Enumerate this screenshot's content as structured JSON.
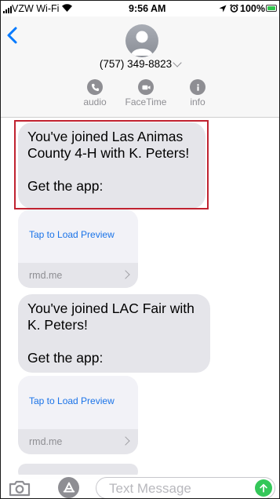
{
  "status": {
    "carrier": "VZW Wi-Fi",
    "time": "9:56 AM",
    "battery_pct": "100%",
    "battery_level": 1.0,
    "battery_color": "#30c44b"
  },
  "header": {
    "contact_number": "(757) 349-8823",
    "actions": [
      {
        "label": "audio",
        "icon": "phone-icon"
      },
      {
        "label": "FaceTime",
        "icon": "video-icon"
      },
      {
        "label": "info",
        "icon": "info-icon"
      }
    ],
    "accent": "#007aff"
  },
  "messages": [
    {
      "line1": "You've joined Las Animas County 4-H with K. Peters!",
      "line2": "Get the app:",
      "highlighted": true
    },
    {
      "line1": "You've joined LAC Fair with K. Peters!",
      "line2": "Get the app:",
      "highlighted": false
    }
  ],
  "link_previews": [
    {
      "load_label": "Tap to Load Preview",
      "domain": "rmd.me"
    },
    {
      "load_label": "Tap to Load Preview",
      "domain": "rmd.me"
    }
  ],
  "composer": {
    "placeholder": "Text Message",
    "value": ""
  },
  "colors": {
    "bubble": "#e5e5ea",
    "highlight_border": "#c02230",
    "send_button": "#34c759"
  }
}
